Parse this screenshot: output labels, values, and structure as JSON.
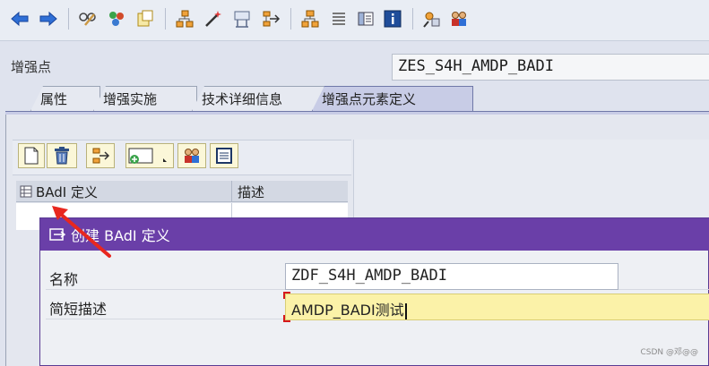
{
  "toolbar": {
    "icons": [
      "back-icon",
      "forward-icon",
      "edit-glasses-icon",
      "other-object-icon",
      "display-change-icon",
      "structure-icon",
      "activate-icon",
      "where-used-icon",
      "transport-icon",
      "hierarchy-icon",
      "list-icon",
      "layout-icon",
      "info-icon",
      "enhance-icon",
      "users-icon"
    ]
  },
  "header": {
    "label": "增强点",
    "value": "ZES_S4H_AMDP_BADI"
  },
  "tabs": [
    {
      "label": "属性",
      "active": false
    },
    {
      "label": "增强实施",
      "active": false
    },
    {
      "label": "技术详细信息",
      "active": false
    },
    {
      "label": "增强点元素定义",
      "active": true
    }
  ],
  "badi_grid": {
    "columns": [
      "BAdI 定义",
      "描述"
    ]
  },
  "dialog": {
    "title": "创建 BAdI 定义",
    "name_label": "名称",
    "name_value": "ZDF_S4H_AMDP_BADI",
    "desc_label": "简短描述",
    "desc_value": "AMDP_BADI测试"
  },
  "watermark": "CSDN @邓@@",
  "colors": {
    "dialog_title_bg": "#6a3fa8",
    "active_tab_bg": "#c8cce6",
    "annotation_arrow": "#e8271f"
  }
}
